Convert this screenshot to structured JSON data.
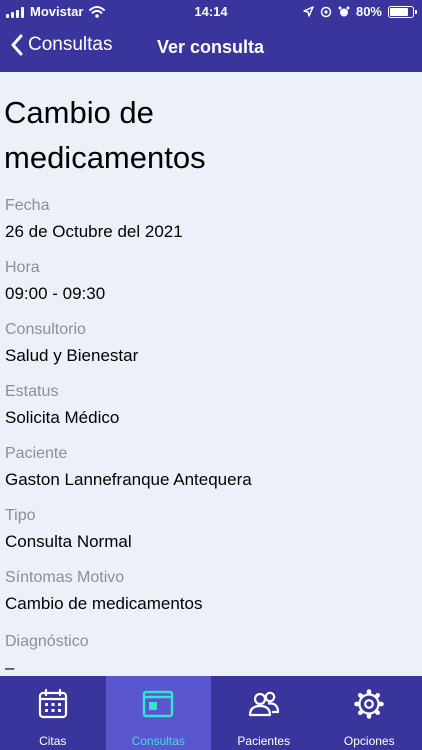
{
  "status": {
    "carrier": "Movistar",
    "time": "14:14",
    "battery": "80%"
  },
  "nav": {
    "back_label": "Consultas",
    "title": "Ver consulta"
  },
  "consulta": {
    "title": "Cambio de medicamentos",
    "fields": [
      {
        "label": "Fecha",
        "value": "26 de Octubre del 2021"
      },
      {
        "label": "Hora",
        "value": "09:00 - 09:30"
      },
      {
        "label": "Consultorio",
        "value": "Salud y Bienestar"
      },
      {
        "label": "Estatus",
        "value": "Solicita Médico"
      },
      {
        "label": "Paciente",
        "value": "Gaston Lannefranque Antequera"
      },
      {
        "label": "Tipo",
        "value": "Consulta Normal"
      },
      {
        "label": "Síntomas Motivo",
        "value": "Cambio de medicamentos"
      },
      {
        "label": "Diagnóstico",
        "value": "–"
      }
    ]
  },
  "tabs": [
    {
      "label": "Citas",
      "icon": "calendar-icon"
    },
    {
      "label": "Consultas",
      "icon": "window-icon",
      "active": true
    },
    {
      "label": "Pacientes",
      "icon": "people-icon"
    },
    {
      "label": "Opciones",
      "icon": "gear-icon"
    }
  ],
  "colors": {
    "primary": "#3a359c",
    "active_tab": "#5a56cf",
    "accent": "#35e3d3",
    "background": "#ecf1f9"
  }
}
